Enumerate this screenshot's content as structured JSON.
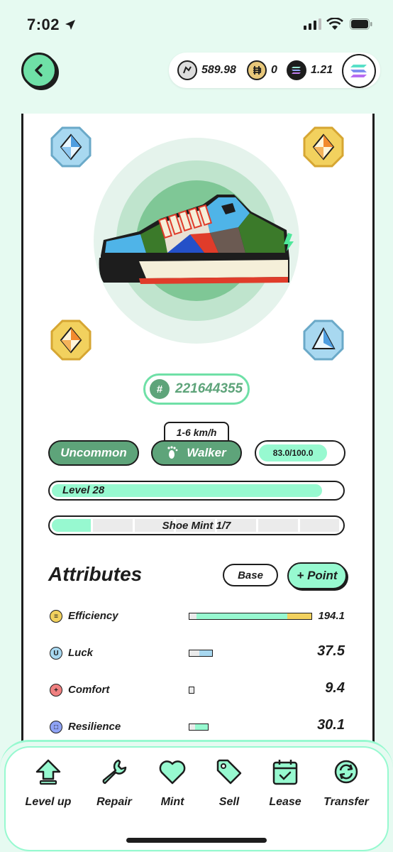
{
  "status_bar": {
    "time": "7:02"
  },
  "header": {
    "back_icon": "chevron-left-icon",
    "wallet": [
      {
        "icon": "gst-coin-icon",
        "amount": "589.98"
      },
      {
        "icon": "gmt-coin-icon",
        "amount": "0"
      },
      {
        "icon": "sol-coin-icon",
        "amount": "1.21"
      }
    ],
    "chain_icon": "solana-icon"
  },
  "shoe": {
    "id_prefix": "#",
    "id": "221644355",
    "speed": "1-6 km/h",
    "rarity": "Uncommon",
    "type": "Walker",
    "durability": "83.0/100.0",
    "durability_fraction": 0.83,
    "level": "Level 28",
    "level_fraction": 0.92,
    "mint": "Shoe Mint 1/7",
    "mint_used": 1,
    "mint_total": 7,
    "gem_slots": [
      "blue-gem-icon",
      "yellow-gem-icon",
      "yellow-gem-icon",
      "blue-gem-icon"
    ]
  },
  "attributes": {
    "title": "Attributes",
    "base_label": "Base",
    "point_label": "+ Point",
    "rows": [
      {
        "name": "Efficiency",
        "value": "194.1",
        "icon": "efficiency-icon"
      },
      {
        "name": "Luck",
        "value": "37.5",
        "icon": "luck-icon"
      },
      {
        "name": "Comfort",
        "value": "9.4",
        "icon": "comfort-icon"
      },
      {
        "name": "Resilience",
        "value": "30.1",
        "icon": "resilience-icon"
      }
    ]
  },
  "bottom_nav": [
    {
      "label": "Level up",
      "icon": "level-up-icon"
    },
    {
      "label": "Repair",
      "icon": "wrench-icon"
    },
    {
      "label": "Mint",
      "icon": "heart-icon"
    },
    {
      "label": "Sell",
      "icon": "tag-icon"
    },
    {
      "label": "Lease",
      "icon": "calendar-icon"
    },
    {
      "label": "Transfer",
      "icon": "transfer-icon"
    }
  ],
  "colors": {
    "background": "#e6faf1",
    "accent": "#97f9d0",
    "primary_green": "#5ea47a",
    "yellow": "#f2c94c",
    "blue": "#a8d8f0"
  }
}
